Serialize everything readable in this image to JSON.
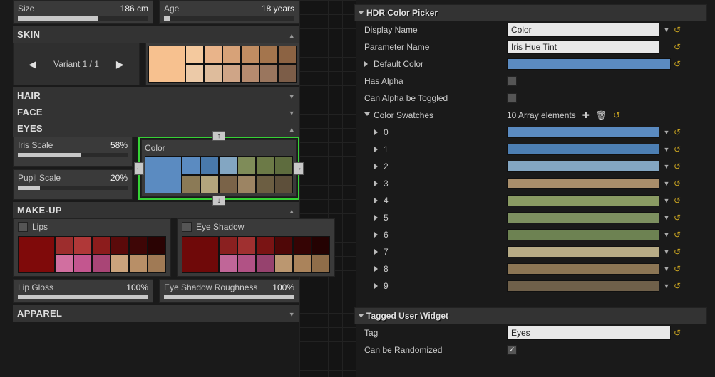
{
  "left": {
    "size_label": "Size",
    "size_val": "186 cm",
    "age_label": "Age",
    "age_val": "18 years",
    "skin_header": "SKIN",
    "variant_text": "Variant 1 / 1",
    "skin_swatches_big": "#f7c18f",
    "skin_swatches": [
      "#f4c99e",
      "#e9b48a",
      "#d7a278",
      "#c18d62",
      "#a4754d",
      "#8c6343",
      "#eccaa8",
      "#debc9c",
      "#cfa587",
      "#b68b6f",
      "#9a765e",
      "#7c5d48"
    ],
    "hair_header": "HAIR",
    "face_header": "FACE",
    "eyes_header": "EYES",
    "iris_label": "Iris Scale",
    "iris_val": "58%",
    "pupil_label": "Pupil Scale",
    "pupil_val": "20%",
    "color_title": "Color",
    "color_big": "#5b8bc1",
    "color_swatches": [
      "#5b8bc1",
      "#4979ab",
      "#83a6c2",
      "#7f8c59",
      "#6c7a47",
      "#5e6c3e",
      "#8b7a56",
      "#b3a57c",
      "#7a6348",
      "#9c8463",
      "#6c5e42",
      "#5d4f3a"
    ],
    "makeup_header": "MAKE-UP",
    "lips_label": "Lips",
    "eyeshadow_label": "Eye Shadow",
    "lips_big": "#7f0a0a",
    "lips_swatches": [
      "#9d2d2d",
      "#b03838",
      "#8c1c1c",
      "#5a0a0a",
      "#3e0606",
      "#2a0303",
      "#d16fa0",
      "#c3568f",
      "#a94576",
      "#cba37c",
      "#b88f67",
      "#a07a55"
    ],
    "eyesh_big": "#6f0909",
    "eyesh_swatches": [
      "#8a2020",
      "#a03030",
      "#7a1414",
      "#4f0707",
      "#350404",
      "#240202",
      "#c06698",
      "#b15285",
      "#96426e",
      "#bb9770",
      "#aa835b",
      "#8f6d49"
    ],
    "lipgloss_label": "Lip Gloss",
    "lipgloss_val": "100%",
    "eyerough_label": "Eye Shadow Roughness",
    "eyerough_val": "100%",
    "apparel_header": "APPAREL"
  },
  "right": {
    "picker_header": "HDR Color Picker",
    "display_label": "Display Name",
    "display_val": "Color",
    "param_label": "Parameter Name",
    "param_val": "Iris Hue Tint",
    "default_label": "Default Color",
    "default_color": "#5b8bc1",
    "alpha_label": "Has Alpha",
    "toggle_label": "Can Alpha be Toggled",
    "swatches_label": "Color Swatches",
    "swatches_count": "10 Array elements",
    "swatch_items": [
      {
        "label": "0",
        "color": "#5b8bc1"
      },
      {
        "label": "1",
        "color": "#4d7fb3"
      },
      {
        "label": "2",
        "color": "#83a6c2"
      },
      {
        "label": "3",
        "color": "#a98e6b"
      },
      {
        "label": "4",
        "color": "#8a9b63"
      },
      {
        "label": "5",
        "color": "#7d9060"
      },
      {
        "label": "6",
        "color": "#6d8252"
      },
      {
        "label": "7",
        "color": "#b7ab86"
      },
      {
        "label": "8",
        "color": "#8c7655"
      },
      {
        "label": "9",
        "color": "#6f604a"
      }
    ],
    "tag_header": "Tagged User Widget",
    "tag_label": "Tag",
    "tag_val": "Eyes",
    "rand_label": "Can be Randomized"
  }
}
